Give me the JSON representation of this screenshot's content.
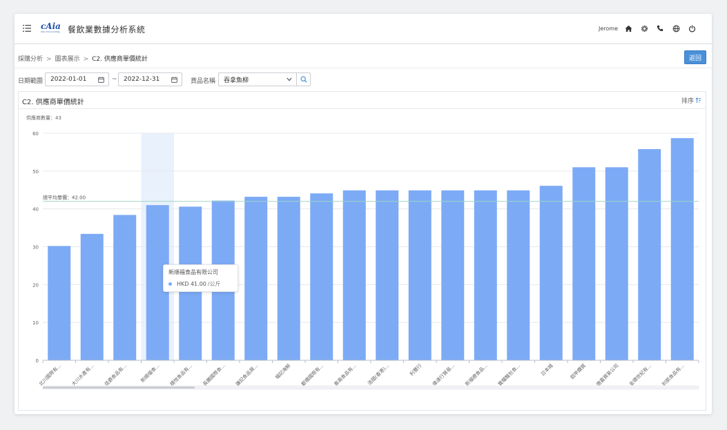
{
  "header": {
    "logo_text": "cAia",
    "logo_subtext": "City of Accounting",
    "app_title": "餐飲業數據分析系統",
    "user_name": "Jerome",
    "icons": [
      "home-icon",
      "gear-icon",
      "phone-icon",
      "globe-icon",
      "power-icon"
    ]
  },
  "breadcrumb": {
    "items": [
      "採購分析",
      "圖表展示",
      "C2. 供應商單價統計"
    ],
    "separator": ">"
  },
  "back_button": "返回",
  "filters": {
    "date_label": "日期範圍",
    "date_from": "2022-01-01",
    "date_to": "2022-12-31",
    "range_separator": "~",
    "product_label": "貨品名稱",
    "product_value": "吞拿魚柳"
  },
  "panel": {
    "title": "C2. 供應商單價統計",
    "sort_label": "排序"
  },
  "colors": {
    "bar": "#7caaf5",
    "highlight": "#e9f1fd",
    "primary": "#4a90d9"
  },
  "chart_data": {
    "type": "bar",
    "count_label": "供應商數量：43",
    "ylim": [
      0,
      60
    ],
    "yticks": [
      "0",
      "10",
      "20",
      "30",
      "40",
      "50",
      "60"
    ],
    "categories": [
      "北川國際有...",
      "大川水產有...",
      "佳爵食品有...",
      "新順福食...",
      "穩悅食品有...",
      "長鵬國際食...",
      "謙記食品貿...",
      "福記海鮮",
      "獻橋國際有...",
      "泰高食品有...",
      "浩國(香港)...",
      "利豐行",
      "偉達行貿易...",
      "新福德食品...",
      "寶耀麵包食...",
      "日本城",
      "鋁甲鑽貿",
      "億嘉貿易公司",
      "金德世紀有...",
      "利凱食品有..."
    ],
    "values": [
      30.2,
      33.4,
      38.4,
      41.0,
      40.6,
      42.2,
      43.2,
      43.2,
      44.1,
      44.9,
      44.9,
      44.9,
      44.9,
      44.9,
      44.9,
      46.1,
      51.0,
      51.0,
      55.8,
      58.7
    ],
    "average_line": {
      "label": "總平均單價：42.00",
      "value": 42.0
    },
    "highlight_index": 3,
    "tooltip": {
      "title": "新順福食品有限公司",
      "value": "HKD 41.00",
      "unit": "/公斤"
    }
  }
}
